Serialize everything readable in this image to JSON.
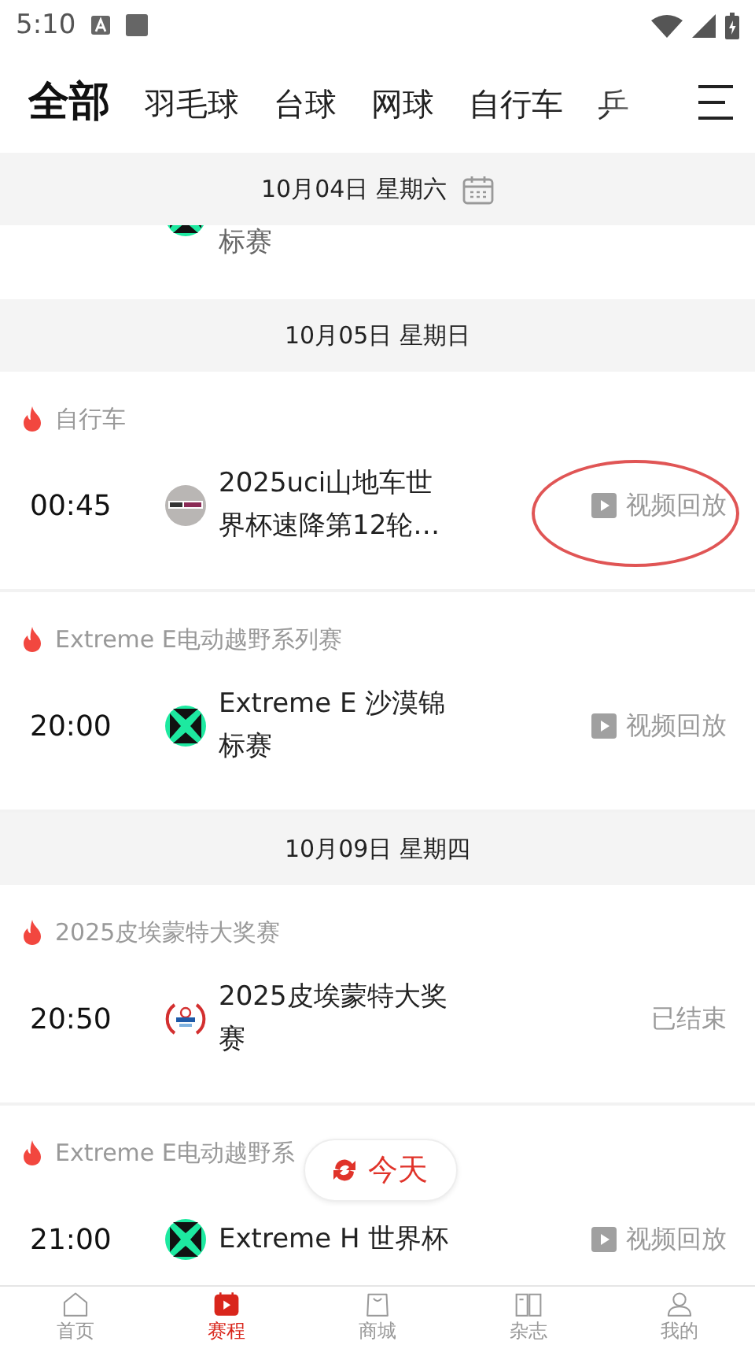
{
  "status_bar": {
    "time": "5:10"
  },
  "tabs": [
    {
      "label": "全部",
      "selected": true
    },
    {
      "label": "羽毛球",
      "selected": false
    },
    {
      "label": "台球",
      "selected": false
    },
    {
      "label": "网球",
      "selected": false
    },
    {
      "label": "自行车",
      "selected": false
    },
    {
      "label": "乒",
      "selected": false
    }
  ],
  "top_date": "10月04日 星期六",
  "partial_row": {
    "kind": "x",
    "title_tail": "标赛"
  },
  "groups": [
    {
      "date": "10月05日 星期日",
      "matches": [
        {
          "category": "自行车",
          "time": "00:45",
          "kind": "grey",
          "title": "2025uci山地车世界杯速降第12轮…",
          "action": {
            "kind": "replay",
            "label": "视频回放"
          },
          "circled": true
        },
        {
          "category": "Extreme E电动越野系列赛",
          "time": "20:00",
          "kind": "x",
          "title": "Extreme E 沙漠锦标赛",
          "action": {
            "kind": "replay",
            "label": "视频回放"
          },
          "circled": false
        }
      ]
    },
    {
      "date": "10月09日 星期四",
      "matches": [
        {
          "category": "2025皮埃蒙特大奖赛",
          "time": "20:50",
          "kind": "crest",
          "title": "2025皮埃蒙特大奖赛",
          "action": {
            "kind": "ended",
            "label": "已结束"
          },
          "circled": false
        },
        {
          "category": "Extreme E电动越野系",
          "time": "21:00",
          "kind": "x",
          "title": "Extreme H 世界杯",
          "action": {
            "kind": "replay",
            "label": "视频回放"
          },
          "circled": false
        }
      ]
    }
  ],
  "today_button": {
    "label": "今天"
  },
  "nav": [
    {
      "label": "首页",
      "selected": false
    },
    {
      "label": "赛程",
      "selected": true
    },
    {
      "label": "商城",
      "selected": false
    },
    {
      "label": "杂志",
      "selected": false
    },
    {
      "label": "我的",
      "selected": false
    }
  ]
}
